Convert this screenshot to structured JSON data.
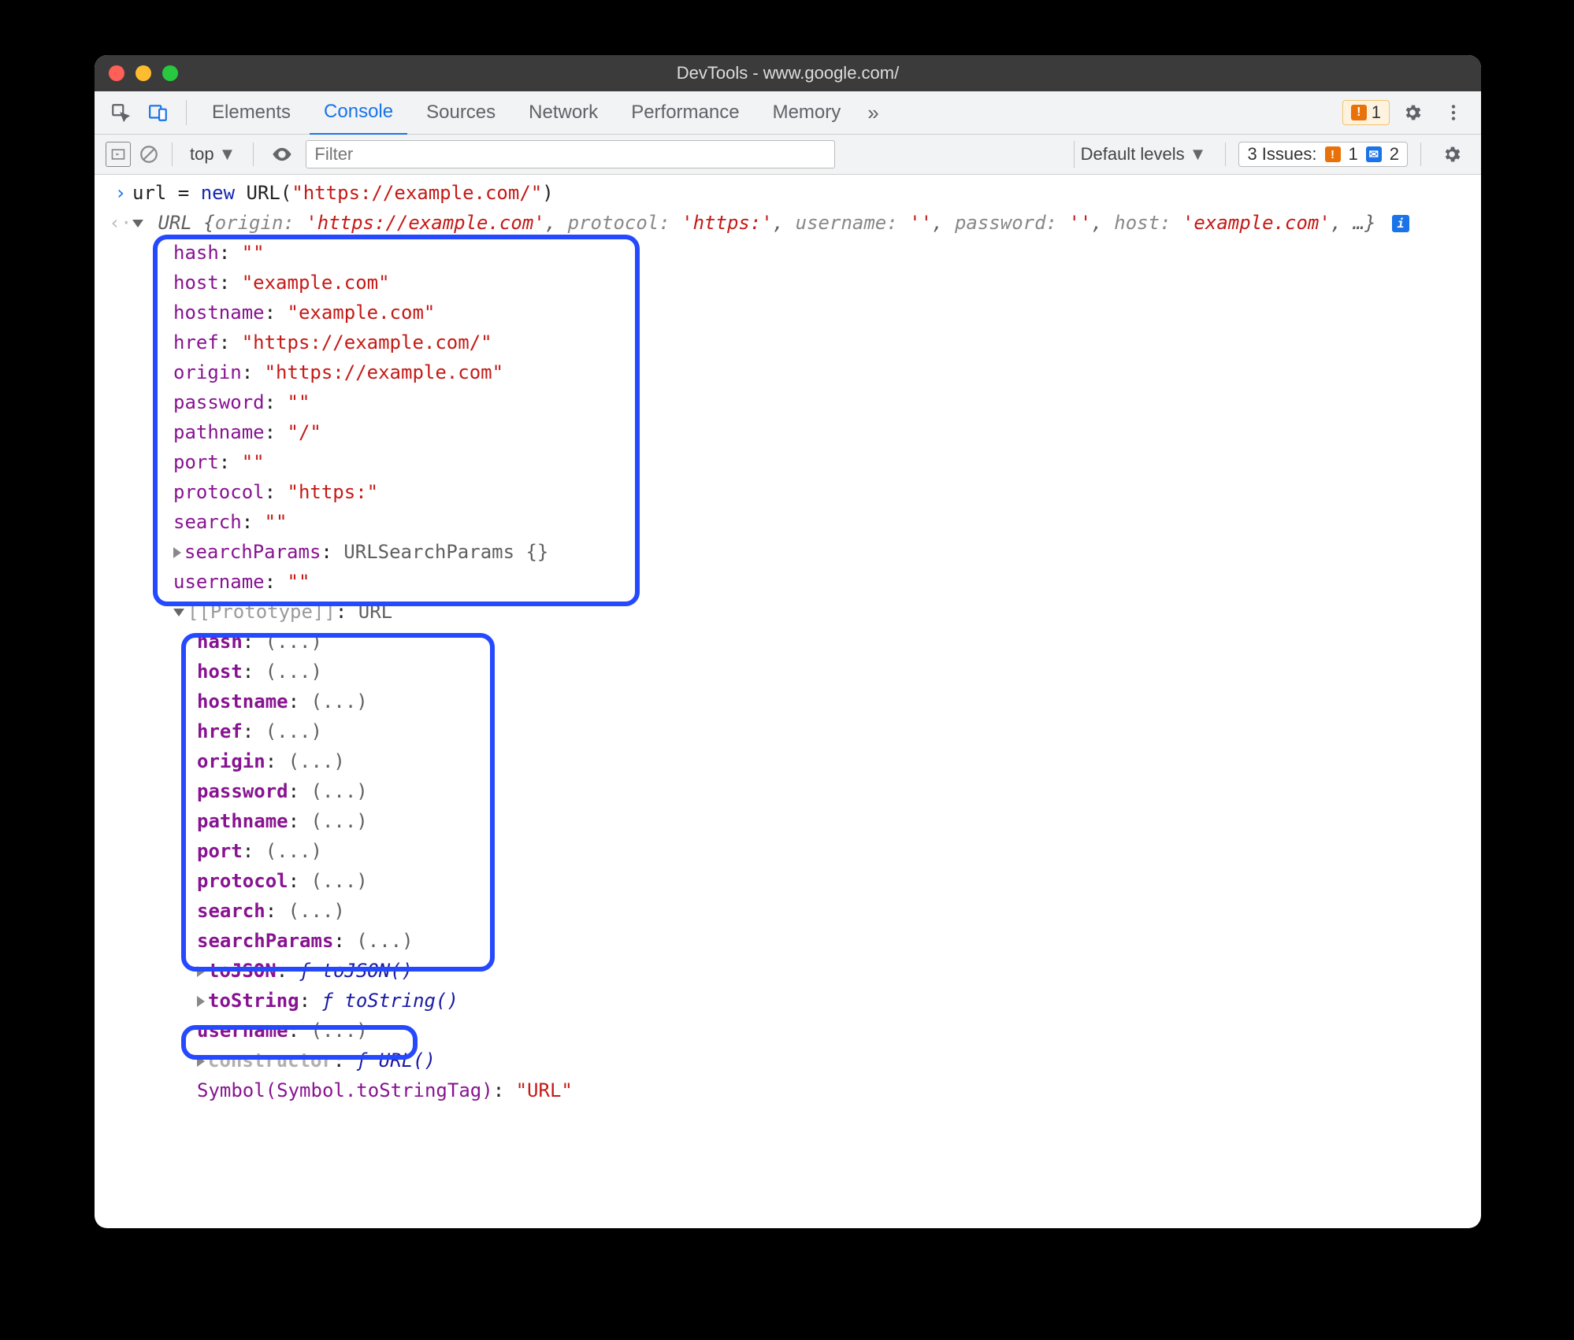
{
  "window": {
    "title": "DevTools - www.google.com/"
  },
  "tabs": {
    "elements": "Elements",
    "console": "Console",
    "sources": "Sources",
    "network": "Network",
    "performance": "Performance",
    "memory": "Memory",
    "more": "»"
  },
  "toolbar": {
    "warn_count": "1",
    "context": "top",
    "filter_placeholder": "Filter",
    "levels": "Default levels",
    "issues_label": "3 Issues:",
    "issues_warn": "1",
    "issues_info": "2"
  },
  "input_line": {
    "var": "url",
    "eq": " = ",
    "kw_new": "new",
    "cls": " URL",
    "paren_open": "(",
    "arg": "\"https://example.com/\"",
    "paren_close": ")"
  },
  "summary": {
    "type": "URL ",
    "brace_open": "{",
    "p1k": "origin: ",
    "p1v": "'https://example.com'",
    "p2k": "protocol: ",
    "p2v": "'https:'",
    "p3k": "username: ",
    "p3v": "''",
    "p4k": "password: ",
    "p4v": "''",
    "p5k": "host: ",
    "p5v": "'example.com'",
    "tail": ", …}",
    "sep": ", "
  },
  "props": {
    "hash": {
      "k": "hash",
      "v": "\"\""
    },
    "host": {
      "k": "host",
      "v": "\"example.com\""
    },
    "hostname": {
      "k": "hostname",
      "v": "\"example.com\""
    },
    "href": {
      "k": "href",
      "v": "\"https://example.com/\""
    },
    "origin": {
      "k": "origin",
      "v": "\"https://example.com\""
    },
    "password": {
      "k": "password",
      "v": "\"\""
    },
    "pathname": {
      "k": "pathname",
      "v": "\"/\""
    },
    "port": {
      "k": "port",
      "v": "\"\""
    },
    "protocol": {
      "k": "protocol",
      "v": "\"https:\""
    },
    "search": {
      "k": "search",
      "v": "\"\""
    },
    "searchParams": {
      "k": "searchParams",
      "v": "URLSearchParams {}"
    },
    "username": {
      "k": "username",
      "v": "\"\""
    }
  },
  "proto": {
    "label": "[[Prototype]]",
    "type": "URL",
    "getters": {
      "hash": "hash",
      "host": "host",
      "hostname": "hostname",
      "href": "href",
      "origin": "origin",
      "password": "password",
      "pathname": "pathname",
      "port": "port",
      "protocol": "protocol",
      "search": "search",
      "searchParams": "searchParams",
      "username": "username"
    },
    "getter_val": "(...)",
    "toJSON_k": "toJSON",
    "toJSON_v": "ƒ toJSON()",
    "toString_k": "toString",
    "toString_v": "ƒ toString()",
    "constructor_k": "constructor",
    "constructor_v": "ƒ URL()",
    "symbol_k": "Symbol(Symbol.toStringTag)",
    "symbol_v": "\"URL\""
  },
  "colon": ": "
}
